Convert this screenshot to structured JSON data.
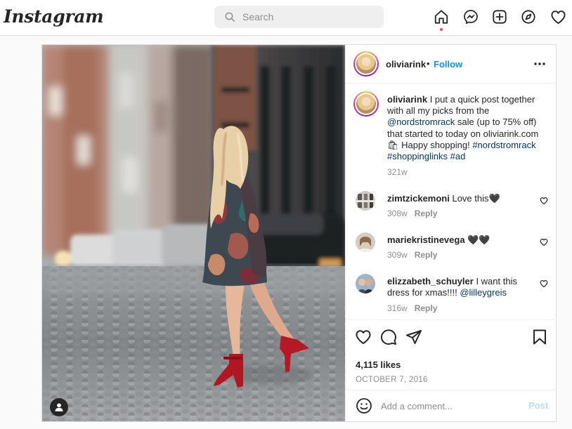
{
  "header": {
    "logo": "Instagram",
    "search_placeholder": "Search"
  },
  "post": {
    "username": "oliviarink",
    "separator": "•",
    "follow_label": "Follow",
    "caption": {
      "username": "oliviarink",
      "text_1": " I put a quick post together with all my picks from the ",
      "mention": "@nordstromrack",
      "text_2": " sale (up to 75% off) that started to today on oliviarink.com 🛍 Happy shopping! ",
      "hashtag_1": "#nordstromrack",
      "hashtag_2": "#shoppinglinks",
      "hashtag_3": "#ad",
      "age": "321w"
    },
    "comments": [
      {
        "username": "zimtzickemoni",
        "text": " Love this🖤",
        "age": "308w",
        "reply": "Reply"
      },
      {
        "username": "mariekristinevega",
        "text": " 🖤🖤",
        "age": "309w",
        "reply": "Reply"
      },
      {
        "username": "elizzabeth_schuyler",
        "text": " I want this dress for xmas!!!! ",
        "mention": "@lilleygreis",
        "age": "316w",
        "reply": "Reply"
      }
    ],
    "likes": "4,115 likes",
    "date": "OCTOBER 7, 2016",
    "add_comment_placeholder": "Add a comment...",
    "post_label": "Post"
  },
  "colors": {
    "accent": "#0095f6",
    "link": "#00376b",
    "muted": "#8e8e8e",
    "post_disabled": "#b2dffc",
    "notification_dot": "#ed4956"
  },
  "icons": {
    "nav": [
      "home-icon",
      "messenger-icon",
      "new-post-icon",
      "explore-icon",
      "activity-heart-icon"
    ],
    "actions": [
      "like-heart-icon",
      "comment-icon",
      "share-icon",
      "save-bookmark-icon"
    ]
  }
}
